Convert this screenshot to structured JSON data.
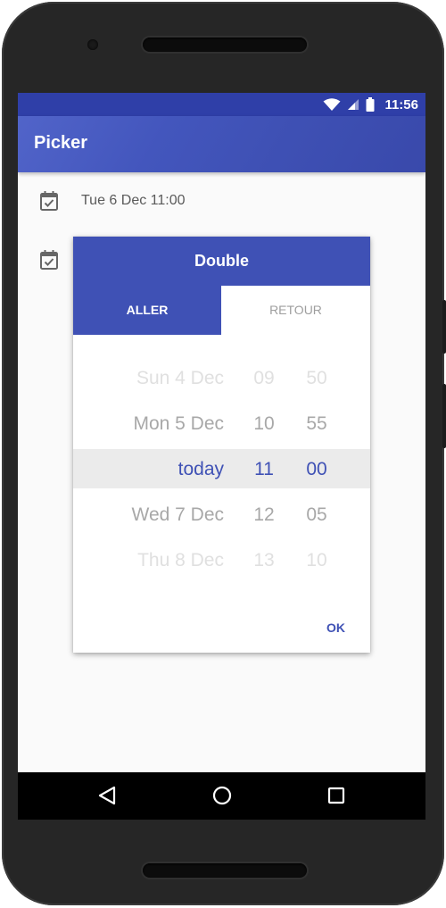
{
  "status_bar": {
    "time": "11:56",
    "wifi_icon": "wifi-icon",
    "signal_icon": "cell-signal-icon",
    "battery_icon": "battery-icon"
  },
  "app_bar": {
    "title": "Picker"
  },
  "rows": [
    {
      "icon": "calendar-check-icon",
      "text": "Tue 6 Dec 11:00"
    },
    {
      "icon": "calendar-check-icon",
      "text": ""
    }
  ],
  "dialog": {
    "title": "Double",
    "tabs": [
      {
        "label": "ALLER",
        "active": true
      },
      {
        "label": "RETOUR",
        "active": false
      }
    ],
    "wheel": [
      {
        "day": "Sun 4 Dec",
        "hour": "09",
        "minute": "50"
      },
      {
        "day": "Mon 5 Dec",
        "hour": "10",
        "minute": "55"
      },
      {
        "day": "today",
        "hour": "11",
        "minute": "00"
      },
      {
        "day": "Wed 7 Dec",
        "hour": "12",
        "minute": "05"
      },
      {
        "day": "Thu 8 Dec",
        "hour": "13",
        "minute": "10"
      }
    ],
    "ok_label": "OK"
  },
  "nav_bar": {
    "back_icon": "back-triangle-icon",
    "home_icon": "home-circle-icon",
    "recents_icon": "recents-square-icon"
  },
  "colors": {
    "primary": "#3f51b5",
    "status_bar": "#2f3fa8",
    "accent_text": "#3f51b5"
  }
}
